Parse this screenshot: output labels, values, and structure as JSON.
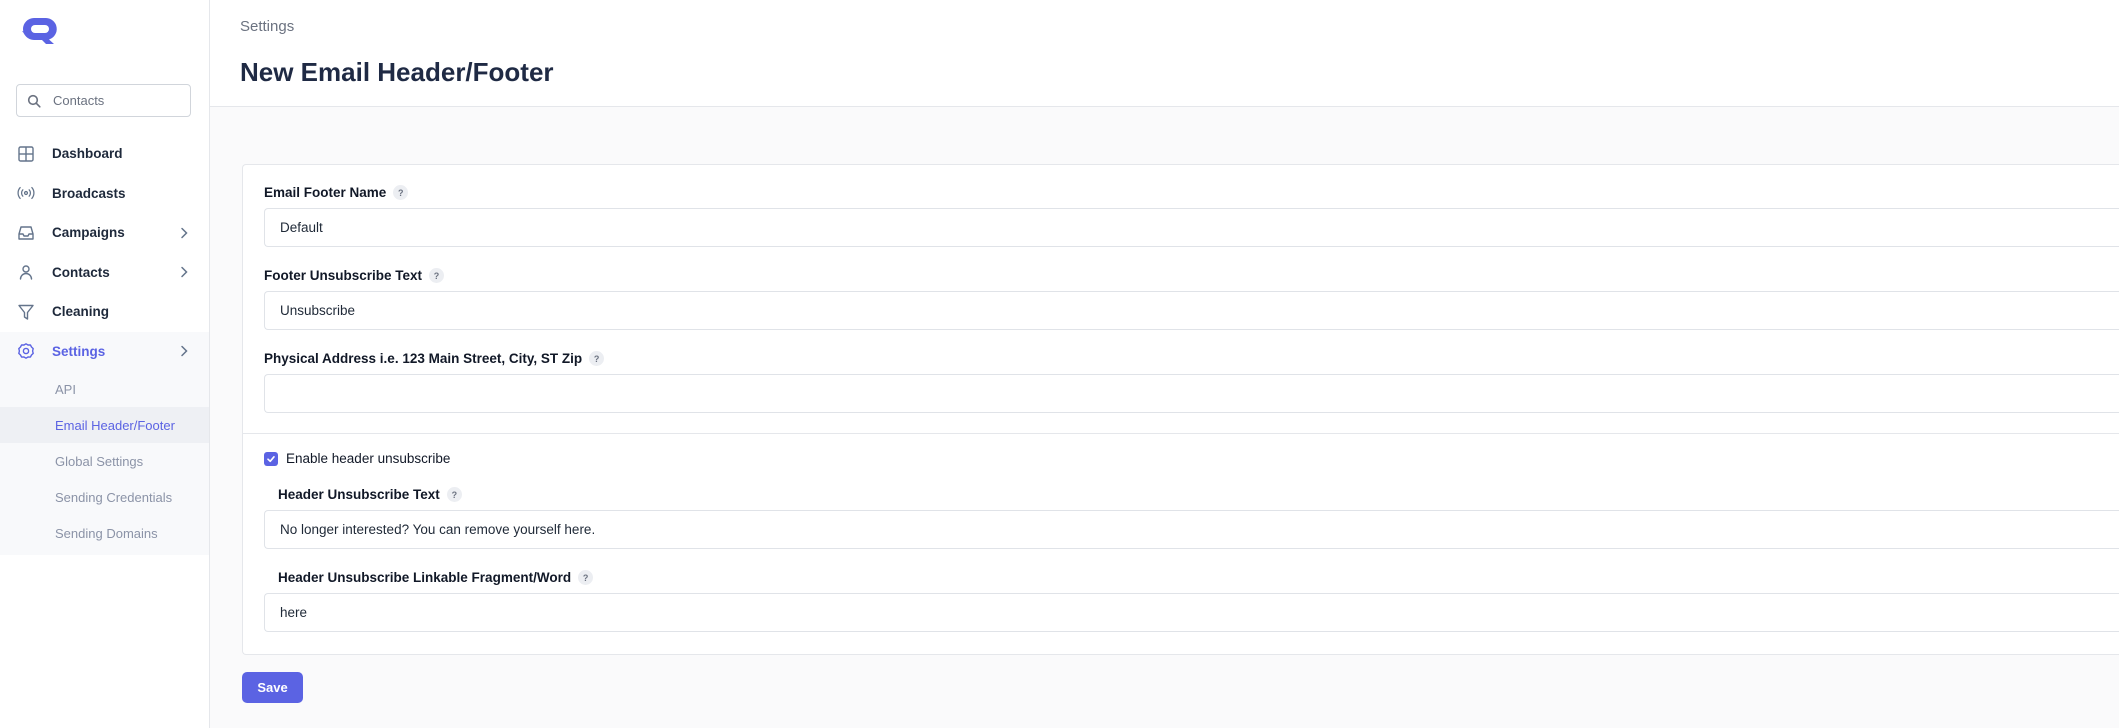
{
  "brand": {
    "accent": "#5b63e3",
    "logo_icon": "rq-logo-icon"
  },
  "search": {
    "placeholder": "Contacts"
  },
  "sidebar": {
    "items": [
      {
        "label": "Dashboard",
        "icon": "grid-icon"
      },
      {
        "label": "Broadcasts",
        "icon": "broadcast-icon"
      },
      {
        "label": "Campaigns",
        "icon": "inbox-icon",
        "has_children": true
      },
      {
        "label": "Contacts",
        "icon": "user-icon",
        "has_children": true
      },
      {
        "label": "Cleaning",
        "icon": "filter-icon"
      },
      {
        "label": "Settings",
        "icon": "gear-icon",
        "has_children": true,
        "active": true
      }
    ],
    "settings_children": [
      {
        "label": "API"
      },
      {
        "label": "Email Header/Footer",
        "active": true
      },
      {
        "label": "Global Settings"
      },
      {
        "label": "Sending Credentials"
      },
      {
        "label": "Sending Domains"
      }
    ]
  },
  "header": {
    "breadcrumb": "Settings",
    "title": "New Email Header/Footer"
  },
  "form": {
    "footer_name": {
      "label": "Email Footer Name",
      "value": "Default"
    },
    "footer_unsubscribe": {
      "label": "Footer Unsubscribe Text",
      "value": "Unsubscribe"
    },
    "physical_address": {
      "label": "Physical Address i.e. 123 Main Street, City, ST Zip",
      "value": ""
    },
    "enable_header_unsubscribe": {
      "label": "Enable header unsubscribe",
      "checked": true
    },
    "header_unsubscribe_text": {
      "label": "Header Unsubscribe Text",
      "value": "No longer interested? You can remove yourself here."
    },
    "header_fragment": {
      "label": "Header Unsubscribe Linkable Fragment/Word",
      "value": "here"
    },
    "help_glyph": "?"
  },
  "actions": {
    "save_label": "Save"
  }
}
